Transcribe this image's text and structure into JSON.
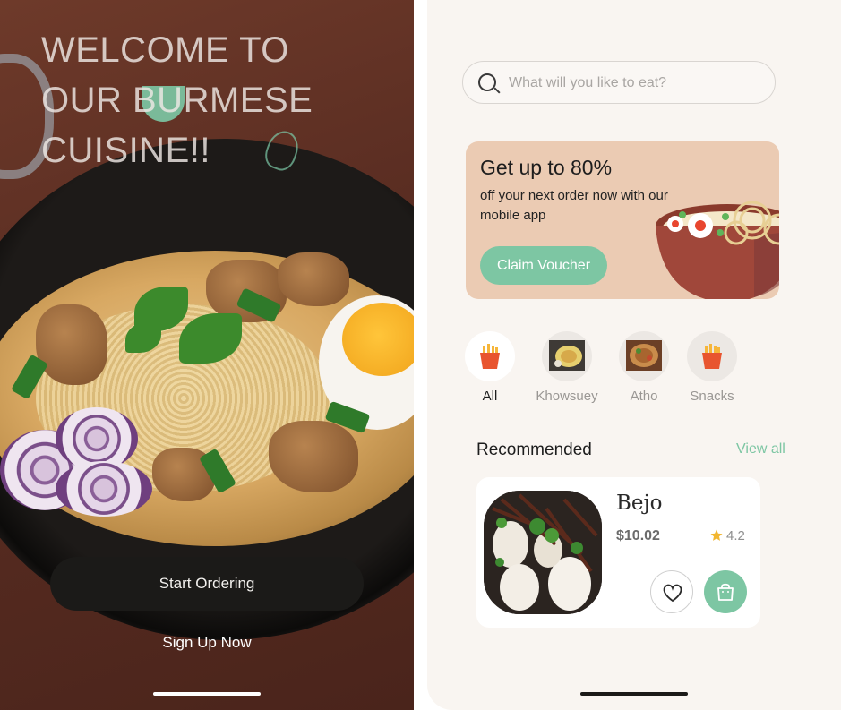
{
  "welcome_screen": {
    "headline_lines": [
      "WELCOME TO",
      "OUR BURMESE",
      "CUISINE!!"
    ],
    "start_button": "Start Ordering",
    "signup_link": "Sign Up Now"
  },
  "home_screen": {
    "search": {
      "placeholder": "What will you like to eat?"
    },
    "promo": {
      "title": "Get up to 80%",
      "subtitle": "off your next order now with our mobile app",
      "button": "Claim Voucher"
    },
    "categories": [
      {
        "label": "All",
        "icon": "fries-icon",
        "active": true
      },
      {
        "label": "Khowsuey",
        "icon": "khowsuey-thumbnail",
        "active": false
      },
      {
        "label": "Atho",
        "icon": "atho-thumbnail",
        "active": false
      },
      {
        "label": "Snacks",
        "icon": "fries-icon",
        "active": false
      }
    ],
    "recommended": {
      "title": "Recommended",
      "view_all": "View all",
      "items": [
        {
          "name": "Bejo",
          "price": "$10.02",
          "rating": "4.2"
        }
      ]
    }
  },
  "colors": {
    "accent_green": "#7dc6a3",
    "promo_bg": "#ebcbb3",
    "dark_button": "#1b1a18",
    "app_bg": "#f9f5f1",
    "star": "#f2b630"
  }
}
